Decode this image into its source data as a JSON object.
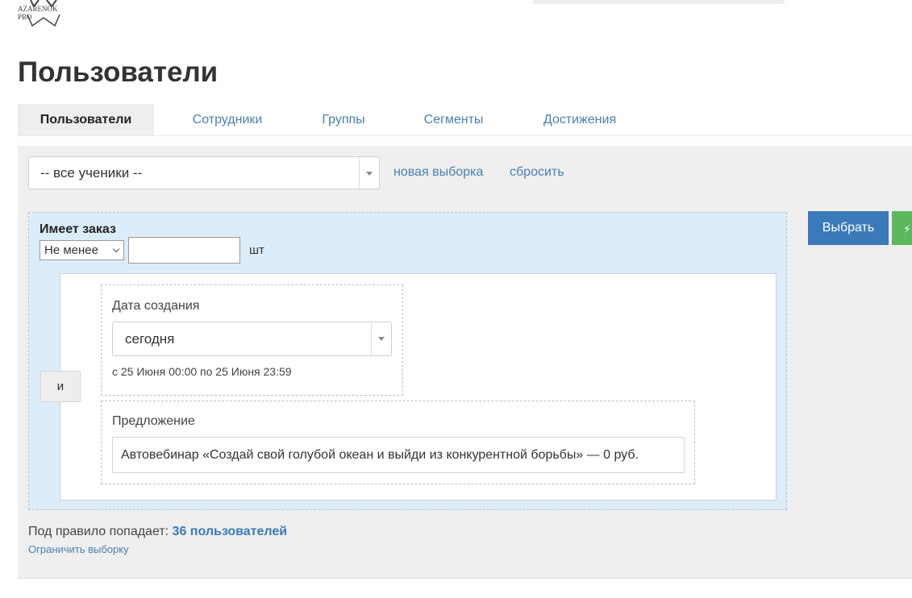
{
  "header": {
    "logo_text": "AZARENOK PRO"
  },
  "page": {
    "title": "Пользователи"
  },
  "tabs": [
    {
      "label": "Пользователи",
      "active": true
    },
    {
      "label": "Сотрудники",
      "active": false
    },
    {
      "label": "Группы",
      "active": false
    },
    {
      "label": "Сегменты",
      "active": false
    },
    {
      "label": "Достижения",
      "active": false
    }
  ],
  "filter": {
    "segment_select_value": "-- все ученики --",
    "new_selection_label": "новая выборка",
    "reset_label": "сбросить"
  },
  "rule": {
    "title": "Имеет заказ",
    "operator_value": "Не менее",
    "count_value": "",
    "unit": "шт",
    "and_label": "и",
    "conditions": {
      "date": {
        "label": "Дата создания",
        "value": "сегодня",
        "hint": "с 25 Июня 00:00 по 25 Июня 23:59"
      },
      "offer": {
        "label": "Предложение",
        "value": "Автовебинар «Создай свой голубой океан и выйди из конкурентной борьбы» — 0 руб."
      }
    }
  },
  "actions": {
    "select_label": "Выбрать"
  },
  "result": {
    "prefix": "Под правило попадает:",
    "count_text": "36 пользователей",
    "restrict_label": "Ограничить выборку"
  },
  "colors": {
    "primary": "#3a7ab8",
    "success": "#5cb85c",
    "link": "#4a80b2",
    "rule_bg": "#ddecf9"
  }
}
